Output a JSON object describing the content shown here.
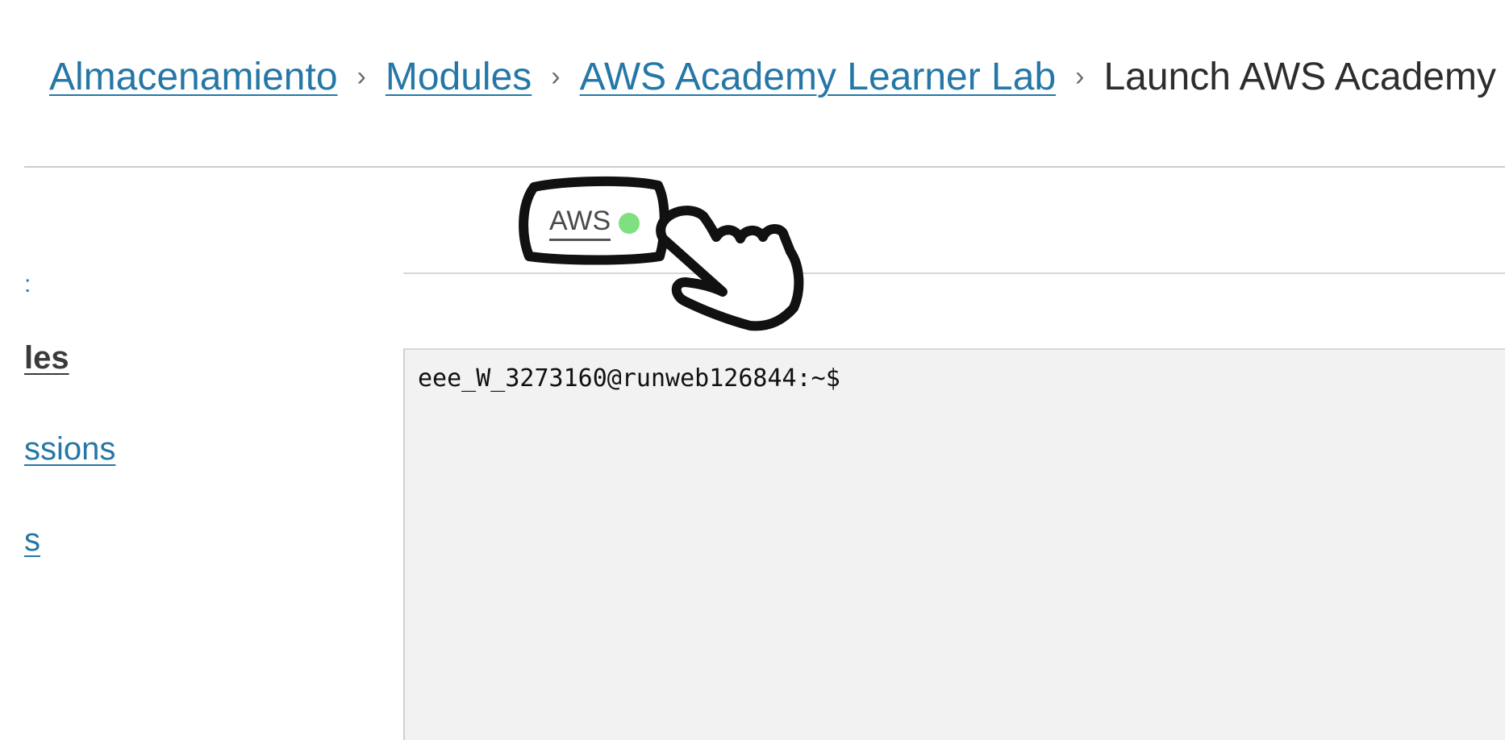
{
  "breadcrumb": {
    "items": [
      "Almacenamiento",
      "Modules",
      "AWS Academy Learner Lab"
    ],
    "current": "Launch AWS Academy Learner Lab",
    "separator": "›"
  },
  "sidebar": {
    "fragment": ":",
    "items": [
      {
        "label": "les",
        "active": true
      },
      {
        "label": "ssions",
        "active": false
      },
      {
        "label": "s",
        "active": false
      }
    ]
  },
  "aws_tab": {
    "label": "AWS",
    "status_color": "#7fe07f"
  },
  "terminal": {
    "prompt": "eee_W_3273160@runweb126844:~$"
  },
  "annotation": {
    "icon": "pointing-hand-icon"
  }
}
